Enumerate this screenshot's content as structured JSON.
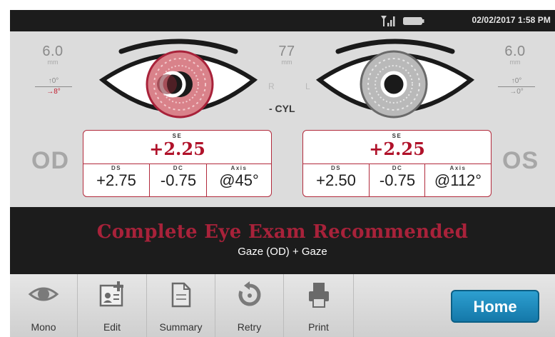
{
  "status": {
    "datetime": "02/02/2017  1:58 PM",
    "signal_icon": "signal-icon",
    "battery_icon": "battery-icon"
  },
  "left_measure": {
    "value": "6.0",
    "unit": "mm"
  },
  "center_measure": {
    "value": "77",
    "unit": "mm"
  },
  "right_measure": {
    "value": "6.0",
    "unit": "mm"
  },
  "left_tilt": {
    "top": "↑0°",
    "bottom": "→8°"
  },
  "right_tilt": {
    "top": "↑0°",
    "bottom": "→0°"
  },
  "eye_letters": {
    "right": "R",
    "left": "L"
  },
  "cyl_label": "- CYL",
  "od": {
    "label": "OD",
    "se_label": "SE",
    "se": "+2.25",
    "ds_label": "DS",
    "ds": "+2.75",
    "dc_label": "DC",
    "dc": "-0.75",
    "axis_label": "Axis",
    "axis": "@45°"
  },
  "os": {
    "label": "OS",
    "se_label": "SE",
    "se": "+2.25",
    "ds_label": "DS",
    "ds": "+2.50",
    "dc_label": "DC",
    "dc": "-0.75",
    "axis_label": "Axis",
    "axis": "@112°"
  },
  "banner": {
    "title": "Complete Eye Exam Recommended",
    "subtitle": "Gaze (OD) + Gaze"
  },
  "toolbar": {
    "mono": "Mono",
    "edit": "Edit",
    "summary": "Summary",
    "retry": "Retry",
    "print": "Print",
    "home": "Home"
  },
  "colors": {
    "accent_red": "#b0122a",
    "home_blue": "#1a88bf",
    "dark_bar": "#1c1c1c"
  }
}
